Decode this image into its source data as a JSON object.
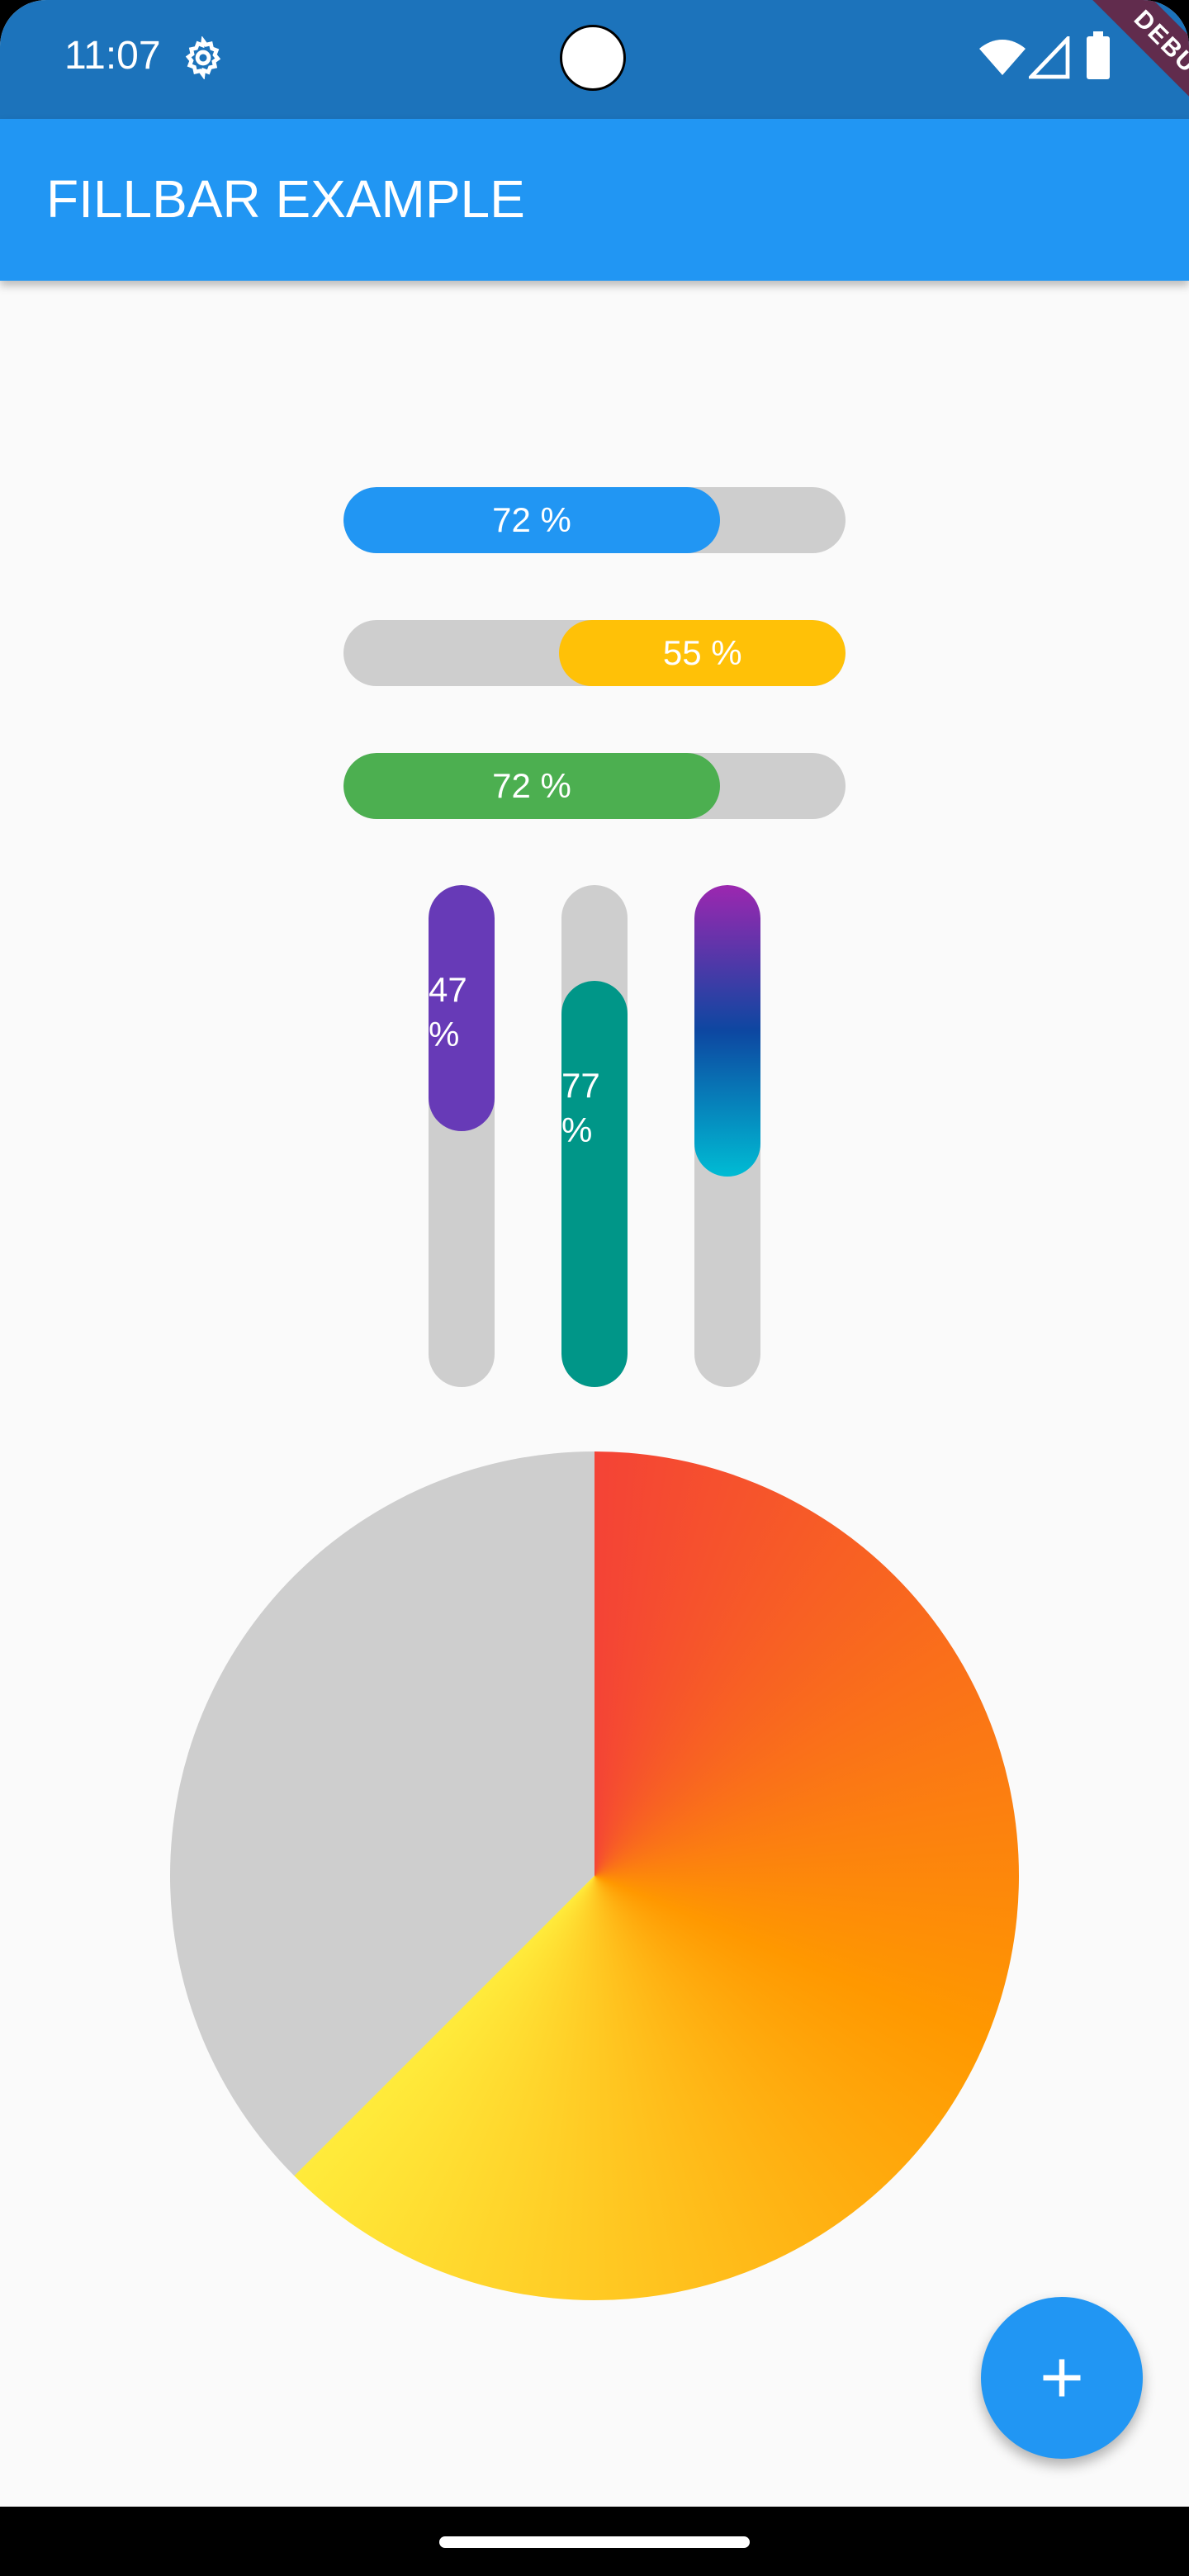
{
  "status_bar": {
    "time": "11:07",
    "icons": [
      "gear-icon",
      "camera-cutout",
      "wifi-icon",
      "signal-icon",
      "battery-icon"
    ],
    "debug_label": "DEBUG"
  },
  "app_bar": {
    "title": "FILLBAR EXAMPLE",
    "color": "#2196f3"
  },
  "horizontal_bars": [
    {
      "label": "72 %",
      "value": 0.75,
      "align": "left",
      "color": "#2196f3"
    },
    {
      "label": "55 %",
      "value": 0.57,
      "align": "right",
      "color": "#ffc107"
    },
    {
      "label": "72 %",
      "value": 0.75,
      "align": "left",
      "color": "#4caf50"
    }
  ],
  "vertical_bars": [
    {
      "label_line1": "47",
      "label_line2": "%",
      "value": 0.49,
      "align": "top",
      "color": "#673ab7"
    },
    {
      "label_line1": "77",
      "label_line2": "%",
      "value": 0.81,
      "align": "bottom",
      "color": "#009688"
    },
    {
      "label_line1": "",
      "label_line2": "",
      "value": 0.58,
      "align": "top",
      "gradient": [
        "#9c27b0",
        "#0d47a1",
        "#00bcd4"
      ]
    }
  ],
  "pie_fill": {
    "value": 0.625,
    "track_color": "#cecece",
    "gradient": [
      "#f44336",
      "#ff9800",
      "#ffeb3b"
    ]
  },
  "fab": {
    "icon": "plus-icon",
    "color": "#2196f3"
  }
}
